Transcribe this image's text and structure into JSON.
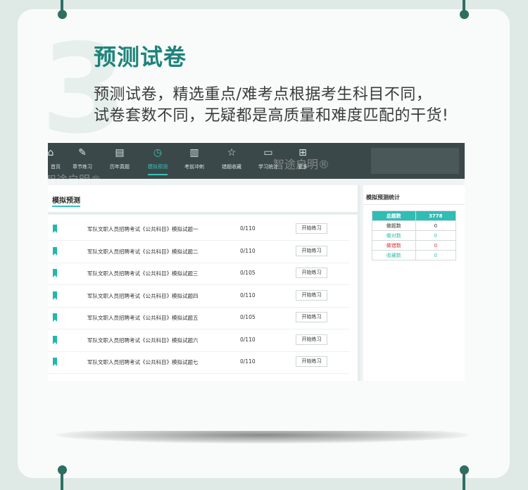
{
  "watermark_number": "3",
  "heading": "预测试卷",
  "description": [
    "预测试卷，精选重点/难考点根据考生科目不同，",
    "试卷套数不同，无疑都是高质量和难度匹配的干货!"
  ],
  "app": {
    "nav": [
      {
        "label": "首页",
        "icon": "home-icon"
      },
      {
        "label": "章节练习",
        "icon": "edit-icon"
      },
      {
        "label": "历年真题",
        "icon": "document-icon"
      },
      {
        "label": "模拟预测",
        "icon": "clock-icon",
        "active": true
      },
      {
        "label": "考前冲刺",
        "icon": "book-icon"
      },
      {
        "label": "错题收藏",
        "icon": "star-icon"
      },
      {
        "label": "学习统计",
        "icon": "stats-icon"
      },
      {
        "label": "更多",
        "icon": "grid-icon"
      }
    ],
    "watermark_text": "智途启明®",
    "panel_title": "模拟预测",
    "exams": [
      {
        "name": "军队文职人员招聘考试《公共科目》模拟试题一",
        "progress": "0/110",
        "button": "开始练习"
      },
      {
        "name": "军队文职人员招聘考试《公共科目》模拟试题二",
        "progress": "0/110",
        "button": "开始练习"
      },
      {
        "name": "军队文职人员招聘考试《公共科目》模拟试题三",
        "progress": "0/105",
        "button": "开始练习"
      },
      {
        "name": "军队文职人员招聘考试《公共科目》模拟试题四",
        "progress": "0/110",
        "button": "开始练习"
      },
      {
        "name": "军队文职人员招聘考试《公共科目》模拟试题五",
        "progress": "0/105",
        "button": "开始练习"
      },
      {
        "name": "军队文职人员招聘考试《公共科目》模拟试题六",
        "progress": "0/110",
        "button": "开始练习"
      },
      {
        "name": "军队文职人员招聘考试《公共科目》模拟试题七",
        "progress": "0/110",
        "button": "开始练习"
      }
    ],
    "stats_title": "模拟预测统计",
    "stats": [
      {
        "label": "总题数",
        "value": "3778",
        "color": "#ffffff"
      },
      {
        "label": "做题数",
        "value": "0",
        "color": "#333333"
      },
      {
        "label": "做对数",
        "value": "0",
        "color": "#2fbdb4"
      },
      {
        "label": "做错数",
        "value": "0",
        "color": "#e03030"
      },
      {
        "label": "收藏数",
        "value": "0",
        "color": "#2fbdb4"
      }
    ]
  },
  "colors": {
    "accent": "#1d847b",
    "teal": "#2fbdb4",
    "topbar": "#3b4849",
    "pin": "#2f6e62"
  }
}
